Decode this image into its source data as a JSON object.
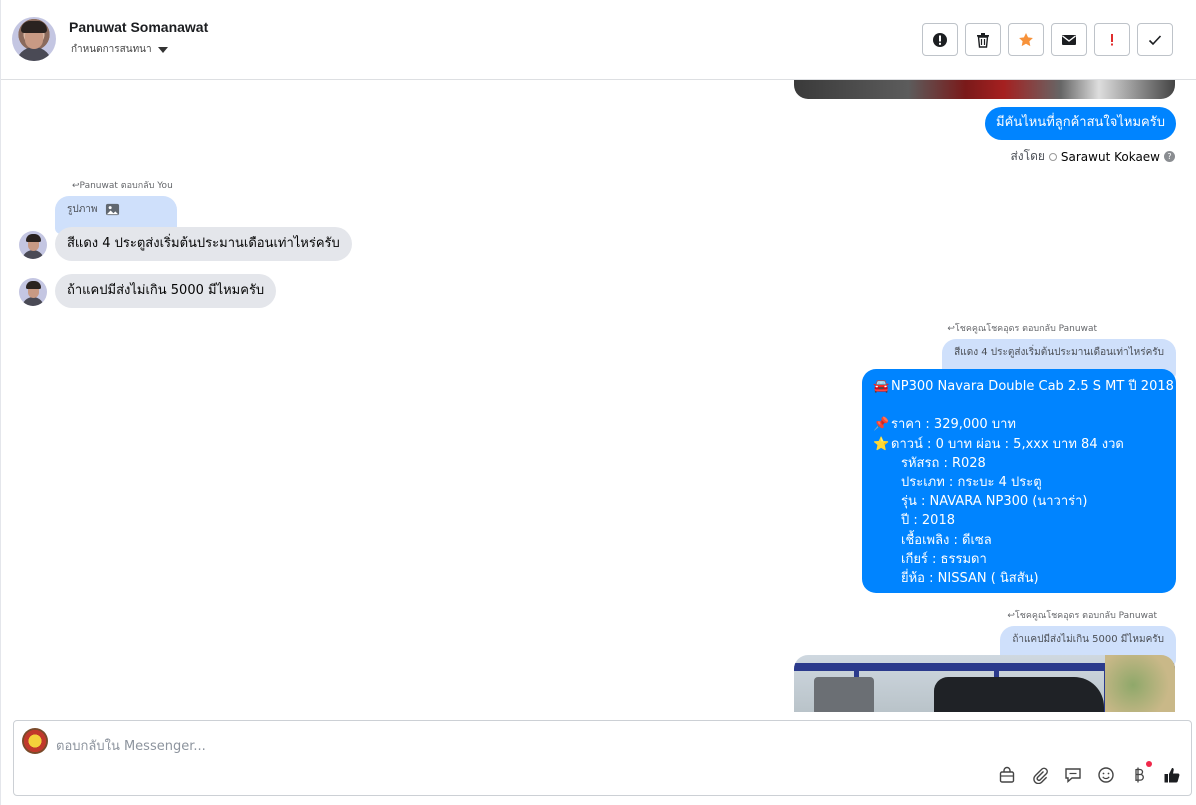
{
  "header": {
    "name": "Panuwat Somanawat",
    "subtitle": "กำหนดการสนทนา"
  },
  "conversation": {
    "top_image_tag": "",
    "msg1": "มีคันไหนที่ลูกค้าสนใจไหมครับ",
    "sent_by_prefix": "ส่งโดย",
    "sent_by_name": "Sarawut Kokaew",
    "sent_by_help": "?",
    "reply1_meta": "Panuwat ตอบกลับ You",
    "reply1_quote": "รูปภาพ",
    "msg2": "สีแดง 4 ประตูส่งเริ่มต้นประมานเดือนเท่าไหร่ครับ",
    "msg3": "ถ้าแคปมีส่งไม่เกิน 5000 มีไหมครับ",
    "reply2_meta": "โชคคูณโชคอุดร ตอบกลับ Panuwat",
    "reply2_quote": "สีแดง 4 ประตูส่งเริ่มต้นประมานเดือนเท่าไหร่ครับ",
    "car": {
      "title": "NP300 Navara Double Cab 2.5 S MT ปี 2018",
      "price": "ราคา : 329,000 บาท",
      "down": "ดาวน์ : 0 บาท ผ่อน : 5,xxx บาท 84 งวด",
      "code": "รหัสรถ : R028",
      "type": "ประเภท : กระบะ 4 ประตู",
      "model": "รุ่น : NAVARA NP300 (นาวาร่า)",
      "year": "ปี : 2018",
      "fuel": "เชื้อเพลิง : ดีเซล",
      "gear": "เกียร์ : ธรรมดา",
      "brand": "ยี่ห้อ : NISSAN ( นิสสัน)",
      "car_emoji": "🚘",
      "pin_emoji": "📌",
      "star_emoji": "⭐"
    },
    "reply3_meta": "โชคคูณโชคอุดร ตอบกลับ Panuwat",
    "reply3_quote": "ถ้าแคปมีส่งไม่เกิน 5000 มีไหมครับ"
  },
  "composer": {
    "placeholder": "ตอบกลับใน Messenger..."
  },
  "colors": {
    "accent": "#0084ff",
    "incoming": "#e4e6eb",
    "quote": "#cfe0fb",
    "star": "#f7923a",
    "alert": "#e02d2d"
  },
  "icons": {
    "header_actions": [
      "info-circle-icon",
      "trash-icon",
      "star-icon",
      "envelope-icon",
      "exclamation-icon",
      "check-icon"
    ],
    "composer_tools": [
      "shopping-bag-icon",
      "paperclip-icon",
      "chat-bubble-icon",
      "smiley-icon",
      "baht-icon",
      "thumbs-up-icon"
    ]
  }
}
